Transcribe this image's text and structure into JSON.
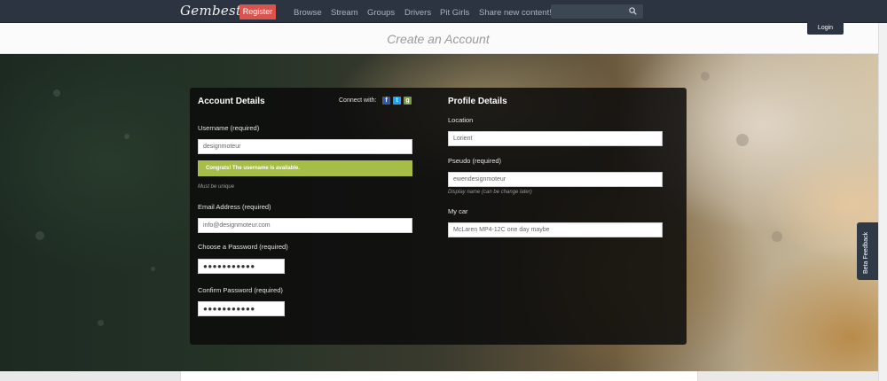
{
  "nav": {
    "logo": "Gembest",
    "register": "Register",
    "links": [
      "Browse",
      "Stream",
      "Groups",
      "Drivers",
      "Pit Girls",
      "Share new content!"
    ],
    "search_placeholder": ""
  },
  "header": {
    "title": "Create an Account",
    "login": "Login"
  },
  "account": {
    "title": "Account Details",
    "connect_label": "Connect with:",
    "username_label": "Username (required)",
    "username_value": "designmoteur",
    "username_success": "Congrats! The username is available.",
    "username_hint": "Must be unique",
    "email_label": "Email Address (required)",
    "email_value": "info@designmoteur.com",
    "password_label": "Choose a Password (required)",
    "password_value": "●●●●●●●●●●●",
    "confirm_label": "Confirm Password (required)",
    "confirm_value": "●●●●●●●●●●●"
  },
  "profile": {
    "title": "Profile Details",
    "location_label": "Location",
    "location_value": "Lorient",
    "pseudo_label": "Pseudo (required)",
    "pseudo_value": "ewendesignmoteur",
    "pseudo_hint": "Display name (can be change later)",
    "car_label": "My car",
    "car_value": "McLaren MP4-12C one day maybe"
  },
  "feedback": {
    "label": "Beta Feedback"
  },
  "colors": {
    "nav_bg": "#2b3440",
    "register_bg": "#d9534f",
    "success_bg": "#a6bd47"
  }
}
